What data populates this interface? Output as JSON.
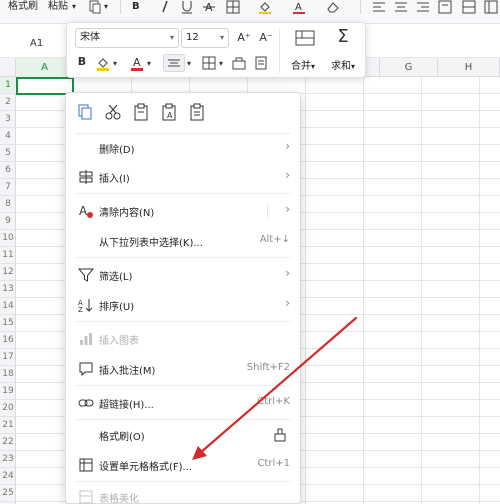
{
  "ribbon": {
    "format_painter": "格式刷",
    "paste": "粘贴",
    "dropdown": "▾"
  },
  "formula": {
    "cell_ref": "A1"
  },
  "grid": {
    "columns": [
      "A",
      "G",
      "H"
    ],
    "rows": [
      "1",
      "2",
      "3",
      "4",
      "5",
      "6",
      "7",
      "8",
      "9",
      "10",
      "11",
      "12",
      "13",
      "14",
      "15",
      "16",
      "17",
      "18",
      "19",
      "20",
      "21",
      "22",
      "23",
      "24",
      "25"
    ]
  },
  "mini_toolbar": {
    "font_name": "宋体",
    "font_size": "12",
    "increase_font": "A⁺",
    "decrease_font": "A⁻",
    "bold": "B",
    "merge": "合并",
    "sum": "求和",
    "caret": "▾",
    "sigma": "Σ"
  },
  "context_menu": {
    "items": [
      {
        "label": "删除(D)",
        "shortcut": ""
      },
      {
        "label": "插入(I)",
        "shortcut": ""
      },
      {
        "label": "清除内容(N)",
        "shortcut": ""
      },
      {
        "label": "从下拉列表中选择(K)...",
        "shortcut": "Alt+↓"
      },
      {
        "label": "筛选(L)",
        "shortcut": ""
      },
      {
        "label": "排序(U)",
        "shortcut": ""
      },
      {
        "label": "插入图表",
        "shortcut": ""
      },
      {
        "label": "插入批注(M)",
        "shortcut": "Shift+F2"
      },
      {
        "label": "超链接(H)...",
        "shortcut": "Ctrl+K"
      },
      {
        "label": "格式刷(O)",
        "shortcut": ""
      },
      {
        "label": "设置单元格格式(F)...",
        "shortcut": "Ctrl+1"
      },
      {
        "label": "表格美化",
        "shortcut": ""
      }
    ],
    "submenu_arrow": "›"
  },
  "colors": {
    "accent_red": "#d32f2f",
    "selection_green": "#1e8e3e",
    "arrow_red": "#d42a2a"
  }
}
